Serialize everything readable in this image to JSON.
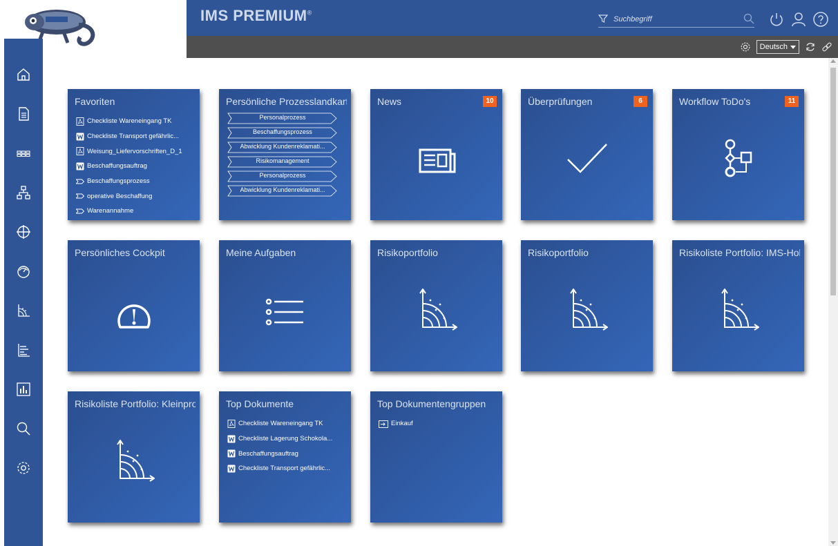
{
  "header": {
    "brand": "IMS PREMIUM",
    "brand_mark": "®",
    "search_placeholder": "Suchbegriff"
  },
  "subheader": {
    "language": "Deutsch"
  },
  "sidebar": {
    "items": [
      {
        "icon": "home-icon"
      },
      {
        "icon": "document-icon"
      },
      {
        "icon": "process-map-icon"
      },
      {
        "icon": "org-chart-icon"
      },
      {
        "icon": "compass-icon"
      },
      {
        "icon": "gauge-icon"
      },
      {
        "icon": "risk-portfolio-icon"
      },
      {
        "icon": "list-chart-icon"
      },
      {
        "icon": "bar-chart-icon"
      },
      {
        "icon": "search-icon"
      },
      {
        "icon": "settings-icon"
      }
    ]
  },
  "tiles": {
    "favoriten": {
      "title": "Favoriten",
      "items": [
        {
          "icon": "pdf",
          "label": "Checkliste Wareneingang TK"
        },
        {
          "icon": "word",
          "label": "Checkliste Transport gefährlic..."
        },
        {
          "icon": "pdf",
          "label": "Weisung_Liefervorschriften_D_1"
        },
        {
          "icon": "word",
          "label": "Beschaffungsauftrag"
        },
        {
          "icon": "process",
          "label": "Beschaffungsprozess"
        },
        {
          "icon": "process",
          "label": "operative Beschaffung"
        },
        {
          "icon": "process",
          "label": "Warenannahme"
        }
      ]
    },
    "prozesslandkarte": {
      "title": "Persönliche Prozesslandkarte",
      "items": [
        "Personalprozess",
        "Beschaffungsprozess",
        "Abwicklung Kundenreklamati...",
        "Risikomanagement",
        "Personalprozess",
        "Abwicklung Kundenreklamati..."
      ]
    },
    "news": {
      "title": "News",
      "badge": "10"
    },
    "ueberpruefungen": {
      "title": "Überprüfungen",
      "badge": "6"
    },
    "workflow": {
      "title": "Workflow ToDo's",
      "badge": "11"
    },
    "cockpit": {
      "title": "Persönliches Cockpit"
    },
    "aufgaben": {
      "title": "Meine Aufgaben"
    },
    "risiko1": {
      "title": "Risikoportfolio"
    },
    "risiko2": {
      "title": "Risikoportfolio"
    },
    "risikoliste_holding": {
      "title": "Risikoliste Portfolio: IMS-Holding"
    },
    "risikoliste_klein": {
      "title": "Risikoliste Portfolio: Kleinprodukte"
    },
    "top_dokumente": {
      "title": "Top Dokumente",
      "items": [
        {
          "icon": "pdf",
          "label": "Checkliste Wareneingang TK"
        },
        {
          "icon": "word",
          "label": "Checkliste Lagerung Schokola..."
        },
        {
          "icon": "word",
          "label": "Beschaffungsauftrag"
        },
        {
          "icon": "word",
          "label": "Checkliste Transport gefährlic..."
        }
      ]
    },
    "top_gruppen": {
      "title": "Top Dokumentengruppen",
      "items": [
        {
          "icon": "folder",
          "label": "Einkauf"
        }
      ]
    }
  },
  "colors": {
    "primary": "#2f5597",
    "subheader": "#4f4f4f",
    "badge": "#f0631f"
  }
}
